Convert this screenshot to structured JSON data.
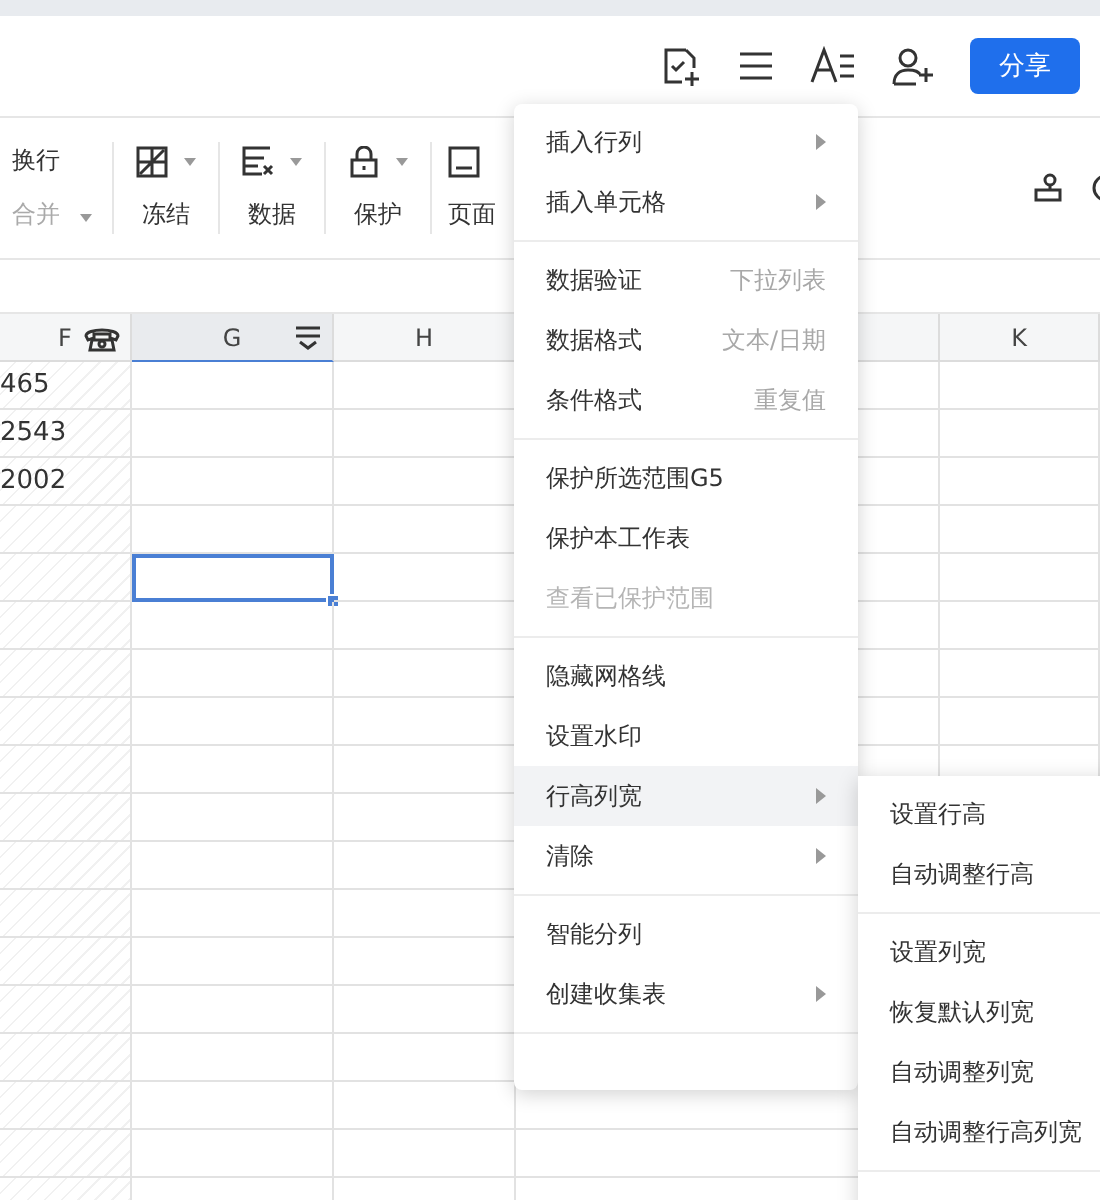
{
  "header": {
    "share_button": "分享"
  },
  "toolbar": {
    "groups": [
      {
        "kind": "stack",
        "top": "换行",
        "bottom": "合并"
      },
      {
        "kind": "freeze",
        "label": "冻结"
      },
      {
        "kind": "data",
        "label": "数据"
      },
      {
        "kind": "lock",
        "label": "保护"
      },
      {
        "kind": "page",
        "label": "页面"
      }
    ]
  },
  "sheet": {
    "columns": [
      {
        "label": "F",
        "kind": "phone"
      },
      {
        "label": "G",
        "kind": "filter"
      },
      {
        "label": "H",
        "kind": "plain"
      },
      {
        "kind": "blank"
      },
      {
        "label": "K",
        "kind": "plain"
      }
    ],
    "rows": [
      [
        {
          "text": "465",
          "selected": false
        },
        {
          "selected": false
        },
        {
          "selected": false
        },
        {
          "selected": false
        },
        {
          "selected": false
        }
      ],
      [
        {
          "text": "2543",
          "selected": false
        },
        {
          "selected": false
        },
        {
          "selected": false
        },
        {
          "selected": false
        },
        {
          "selected": false
        }
      ],
      [
        {
          "text": "2002",
          "selected": false
        },
        {
          "selected": false
        },
        {
          "selected": false
        },
        {
          "selected": false
        },
        {
          "selected": false
        }
      ],
      [
        {
          "selected": false
        },
        {
          "selected": false
        },
        {
          "selected": false
        },
        {
          "selected": false
        },
        {
          "selected": false
        }
      ],
      [
        {
          "selected": false
        },
        {
          "selected": true
        },
        {
          "selected": false
        },
        {
          "selected": false
        },
        {
          "selected": false
        }
      ]
    ]
  },
  "context_menu": {
    "groups": [
      [
        {
          "label": "插入行列",
          "submenu": true,
          "disabled": false,
          "selected": false
        },
        {
          "label": "插入单元格",
          "submenu": true,
          "disabled": false,
          "selected": false
        }
      ],
      [
        {
          "label": "数据验证",
          "hint": "下拉列表",
          "submenu": false,
          "disabled": false,
          "selected": false
        },
        {
          "label": "数据格式",
          "hint": "文本/日期",
          "submenu": false,
          "disabled": false,
          "selected": false
        },
        {
          "label": "条件格式",
          "hint": "重复值",
          "submenu": false,
          "disabled": false,
          "selected": false
        }
      ],
      [
        {
          "label": "保护所选范围G5",
          "submenu": false,
          "disabled": false,
          "selected": false
        },
        {
          "label": "保护本工作表",
          "submenu": false,
          "disabled": false,
          "selected": false
        },
        {
          "label": "查看已保护范围",
          "submenu": false,
          "disabled": true,
          "selected": false
        }
      ],
      [
        {
          "label": "隐藏网格线",
          "submenu": false,
          "disabled": false,
          "selected": false
        },
        {
          "label": "设置水印",
          "submenu": false,
          "disabled": false,
          "selected": false
        },
        {
          "label": "行高列宽",
          "submenu": true,
          "disabled": false,
          "selected": true
        },
        {
          "label": "清除",
          "submenu": true,
          "disabled": false,
          "selected": false
        }
      ],
      [
        {
          "label": "智能分列",
          "submenu": false,
          "disabled": false,
          "selected": false
        },
        {
          "label": "创建收集表",
          "submenu": true,
          "disabled": false,
          "selected": false
        }
      ]
    ]
  },
  "submenu": {
    "groups": [
      [
        {
          "label": "设置行高"
        },
        {
          "label": "自动调整行高"
        }
      ],
      [
        {
          "label": "设置列宽"
        },
        {
          "label": "恢复默认列宽"
        },
        {
          "label": "自动调整列宽"
        },
        {
          "label": "自动调整行高列宽"
        }
      ]
    ]
  }
}
